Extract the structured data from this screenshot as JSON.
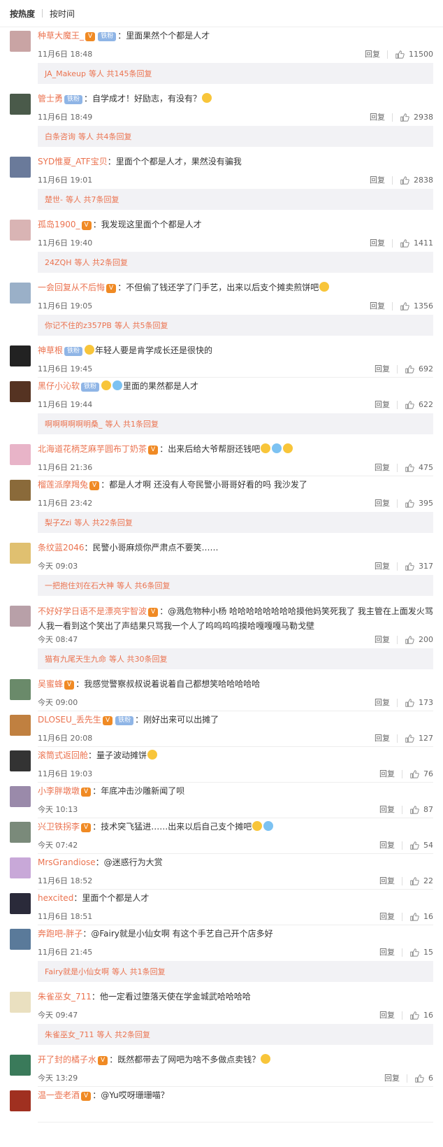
{
  "sort_tabs": {
    "by_hot": "按热度",
    "by_time": "按时间"
  },
  "reply_label": "回复",
  "comments": [
    {
      "user": "种草大魔王_",
      "badges": [
        "vip",
        "铁粉"
      ],
      "text": "：里面果然个个都是人才",
      "time": "11月6日 18:48",
      "likes": "11500",
      "reply": {
        "name": "JA_Makeup",
        "suffix": "等人 共145条回复"
      }
    },
    {
      "user": "管士勇",
      "badges": [
        "铁粉"
      ],
      "text": "：自学成才！好励志，有没有？",
      "emojis": 1,
      "time": "11月6日 18:49",
      "likes": "2938",
      "reply": {
        "name": "白条咨询",
        "suffix": "等人 共4条回复"
      }
    },
    {
      "user": "SYD惟夏_ATF宝贝",
      "badges": [],
      "text": "：里面个个都是人才，果然没有骗我",
      "time": "11月6日 19:01",
      "likes": "2838",
      "reply": {
        "name": "楚世-",
        "suffix": "等人 共7条回复"
      }
    },
    {
      "user": "孤岛1900_",
      "badges": [
        "vip"
      ],
      "text": "：我发现这里面个个都是人才",
      "time": "11月6日 19:40",
      "likes": "1411",
      "reply": {
        "name": "24ZQH",
        "suffix": "等人 共2条回复"
      }
    },
    {
      "user": "一会回复从不后悔",
      "badges": [
        "vip"
      ],
      "text": "：不但偷了钱还学了门手艺，出来以后支个摊卖煎饼吧",
      "emojis": 1,
      "time": "11月6日 19:05",
      "likes": "1356",
      "reply": {
        "name": "你记不住的z357PB",
        "suffix": "等人 共5条回复"
      }
    },
    {
      "user": "神草根",
      "badges": [
        "铁粉"
      ],
      "text": "年轻人要是肯学成长还是很快的",
      "emojis_before": 1,
      "time": "11月6日 19:45",
      "likes": "692"
    },
    {
      "user": "黑仔小沁软",
      "badges": [
        "铁粉"
      ],
      "text": "里面的果然都是人才",
      "emojis_before": 2,
      "time": "11月6日 19:44",
      "likes": "622",
      "reply": {
        "name": "啊啊啊啊啊明桑_",
        "suffix": "等人 共1条回复"
      }
    },
    {
      "user": "北海道花柄芝麻芋圆布丁奶茶",
      "badges": [
        "vip"
      ],
      "text": "：出来后给大爷帮厨还钱吧",
      "emojis": 3,
      "time": "11月6日 21:36",
      "likes": "475"
    },
    {
      "user": "榴莲派摩羯兔",
      "badges": [
        "vip"
      ],
      "text": "：都是人才啊 还没有人夸民警小哥哥好看的吗 我沙发了",
      "time": "11月6日 23:42",
      "likes": "395",
      "reply": {
        "name": "梨子Zzi",
        "suffix": "等人 共22条回复"
      }
    },
    {
      "user": "条纹蓝2046",
      "badges": [],
      "text": "：民警小哥麻烦你严肃点不要笑……",
      "time": "今天 09:03",
      "likes": "317",
      "reply": {
        "name": "一把抱住刘在石大神",
        "suffix": "等人 共6条回复"
      }
    },
    {
      "user": "不好好学日语不是漂亮宇智波",
      "badges": [
        "vip"
      ],
      "text": "：@溅危物种小杨 哈哈哈哈哈哈哈哈摸他妈笑死我了 我主管在上面发火骂人我一看到这个笑出了声结果只骂我一个人了呜呜呜呜摸哈嘎嘎嘎马勒戈壁",
      "wrap": true,
      "time": "今天 08:47",
      "likes": "200",
      "reply": {
        "name": "猫有九尾天生九命",
        "suffix": "等人 共30条回复"
      }
    },
    {
      "user": "吴蜜蜂",
      "badges": [
        "vip"
      ],
      "text": "：我感觉警察叔叔说着说着自己都想笑哈哈哈哈哈",
      "time": "今天 09:00",
      "likes": "173"
    },
    {
      "user": "DLOSEU_丢先生",
      "badges": [
        "vip",
        "铁粉"
      ],
      "text": "：刚好出来可以出摊了",
      "time": "11月6日 20:08",
      "likes": "127"
    },
    {
      "user": "滚筒式返回舱",
      "badges": [],
      "text": "：量子波动摊饼",
      "emojis": 1,
      "time": "11月6日 19:03",
      "likes": "76"
    },
    {
      "user": "小李胖墩墩",
      "badges": [
        "vip"
      ],
      "text": "：年底冲击沙雕新闻了呗",
      "time": "今天 10:13",
      "likes": "87"
    },
    {
      "user": "兴卫铁拐李",
      "badges": [
        "vip"
      ],
      "text": "：技术突飞猛进……出来以后自己支个摊吧",
      "emojis": 2,
      "time": "今天 07:42",
      "likes": "54"
    },
    {
      "user": "MrsGrandiose",
      "badges": [],
      "text": "：@迷惑行为大赏",
      "time": "11月6日 18:52",
      "likes": "22"
    },
    {
      "user": "hexcited",
      "badges": [],
      "text": "：里面个个都是人才",
      "time": "11月6日 18:51",
      "likes": "16"
    },
    {
      "user": "奔跑吧-胖子",
      "badges": [],
      "text": "：@Fairy就是小仙女啊 有这个手艺自己开个店多好",
      "time": "11月6日 21:45",
      "likes": "15",
      "reply": {
        "name": "Fairy就是小仙女啊",
        "suffix": "等人 共1条回复"
      }
    },
    {
      "user": "朱雀巫女_711",
      "badges": [],
      "text": "：他一定看过堕落天使在学金城武哈哈哈哈",
      "time": "今天 09:47",
      "likes": "16",
      "reply": {
        "name": "朱雀巫女_711",
        "suffix": "等人 共2条回复"
      }
    },
    {
      "user": "开了封的橘子水",
      "badges": [
        "vip"
      ],
      "text": "：既然都带去了网吧为啥不多做点卖钱？",
      "emojis": 1,
      "time": "今天 13:29",
      "likes": "6"
    },
    {
      "user": "温一壶老酒",
      "badges": [
        "vip"
      ],
      "text": "：@Yu哎呀珊珊喵？",
      "time": "",
      "likes": ""
    }
  ],
  "colors": {
    "username": "#eb7350",
    "reply_bg": "#f2f2f5",
    "vip": "#f08a24",
    "fan": "#8fb5e6"
  }
}
